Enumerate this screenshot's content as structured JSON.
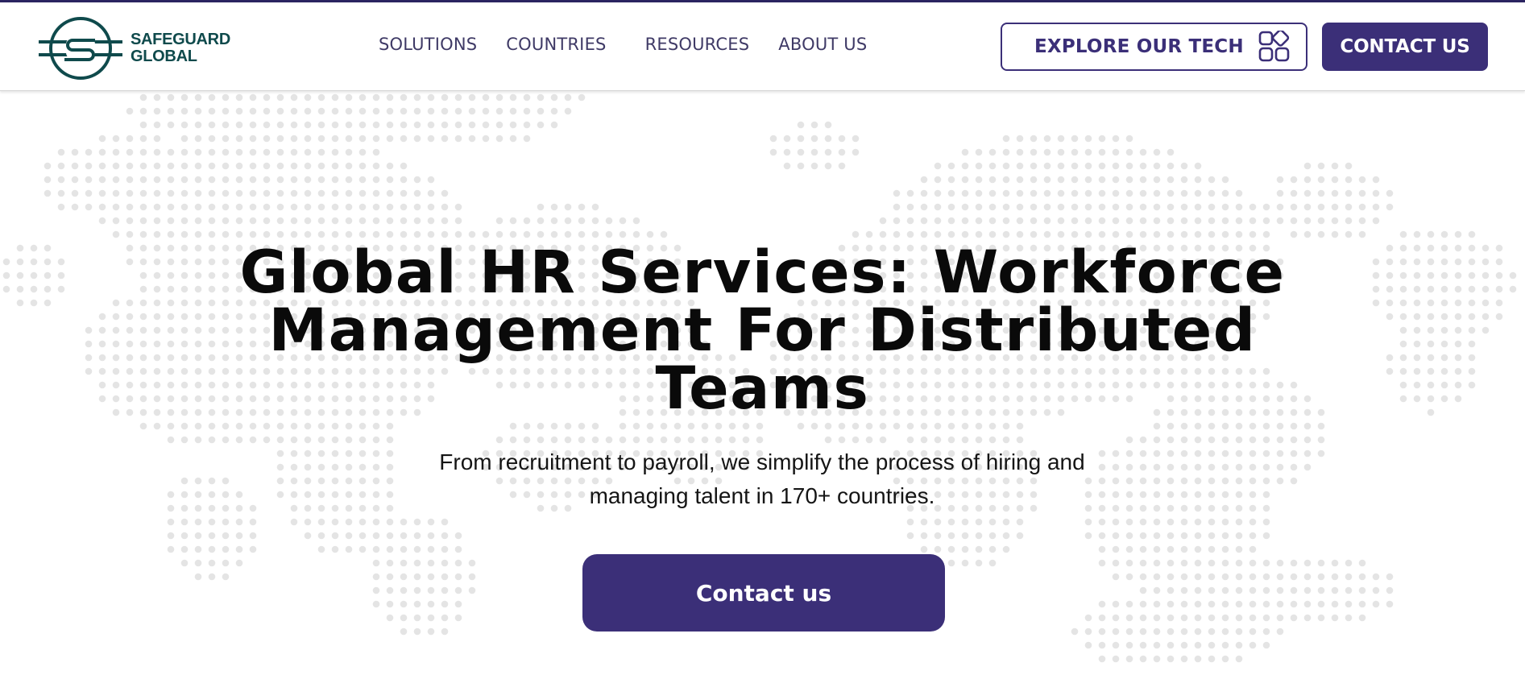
{
  "brand": {
    "name_line1": "SAFEGUARD",
    "name_line2": "GLOBAL",
    "logo_color": "#0f4a4c"
  },
  "nav": {
    "items": [
      {
        "label": "SOLUTIONS"
      },
      {
        "label": "COUNTRIES"
      },
      {
        "label": "RESOURCES"
      },
      {
        "label": "ABOUT US"
      }
    ]
  },
  "header_actions": {
    "explore_label": "EXPLORE OUR TECH",
    "explore_icon": "apps-grid-icon",
    "contact_label": "CONTACT US"
  },
  "hero": {
    "title": "Global HR Services: Workforce Management For Distributed Teams",
    "subtitle_line1": "From recruitment to payroll, we simplify the process of hiring and",
    "subtitle_line2": "managing talent in 170+ countries.",
    "cta_label": "Contact us"
  },
  "theme": {
    "primary": "#3b2f78",
    "nav_text": "#3f3a66",
    "map_dots": "#e4e4e4",
    "background": "#ffffff"
  }
}
